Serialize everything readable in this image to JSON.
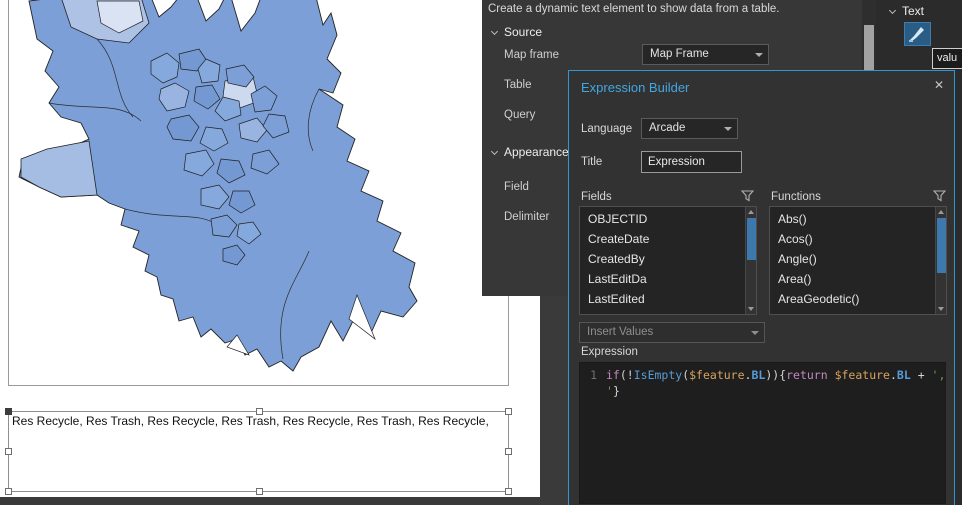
{
  "layout": {
    "dynamic_text": "Res Recycle, Res Trash, Res Recycle, Res Trash, Res Recycle, Res Trash, Res Recycle,"
  },
  "popover": {
    "description": "Create a dynamic text element to show data from a table.",
    "source_section": "Source",
    "map_frame_label": "Map frame",
    "map_frame_value": "Map Frame",
    "table_label": "Table",
    "query_label": "Query",
    "appearance_section": "Appearance",
    "field_label": "Field",
    "delimiter_label": "Delimiter"
  },
  "dialog": {
    "title": "Expression Builder",
    "close_label": "✕",
    "language_label": "Language",
    "language_value": "Arcade",
    "title_label": "Title",
    "title_value": "Expression",
    "fields_label": "Fields",
    "functions_label": "Functions",
    "fields": [
      "OBJECTID",
      "CreateDate",
      "CreatedBy",
      "LastEditDa",
      "LastEdited"
    ],
    "functions": [
      "Abs()",
      "Acos()",
      "Angle()",
      "Area()",
      "AreaGeodetic()"
    ],
    "insert_values_label": "Insert Values",
    "expression_label": "Expression",
    "code": {
      "line_number": "1",
      "lines": [
        [
          {
            "t": "if",
            "c": "kw"
          },
          {
            "t": "(!",
            "c": "pl"
          },
          {
            "t": "IsEmpty",
            "c": "fn"
          },
          {
            "t": "(",
            "c": "pl"
          },
          {
            "t": "$feature",
            "c": "var"
          },
          {
            "t": ".",
            "c": "pl"
          },
          {
            "t": "BL",
            "c": "prop"
          },
          {
            "t": ")){",
            "c": "pl"
          },
          {
            "t": "return",
            "c": "kw"
          },
          {
            "t": " ",
            "c": "pl"
          },
          {
            "t": "$feature",
            "c": "var"
          },
          {
            "t": ".",
            "c": "pl"
          },
          {
            "t": "BL",
            "c": "prop"
          },
          {
            "t": " + ",
            "c": "pl"
          },
          {
            "t": "', ",
            "c": "str"
          }
        ],
        [
          {
            "t": "'",
            "c": "str"
          },
          {
            "t": "}",
            "c": "pl"
          }
        ]
      ]
    }
  },
  "text_pane": {
    "header": "Text",
    "value_text": "valu"
  },
  "colors": {
    "dialog_border": "#2f97d4",
    "dialog_title": "#42a7e0",
    "map_fill": "#7b9fd6",
    "map_fill_light": "#aec2e6",
    "map_fill_pale": "#d9e3f4",
    "list_scroll_thumb": "#3e79ae",
    "symbol_button": "#2a5d86"
  }
}
